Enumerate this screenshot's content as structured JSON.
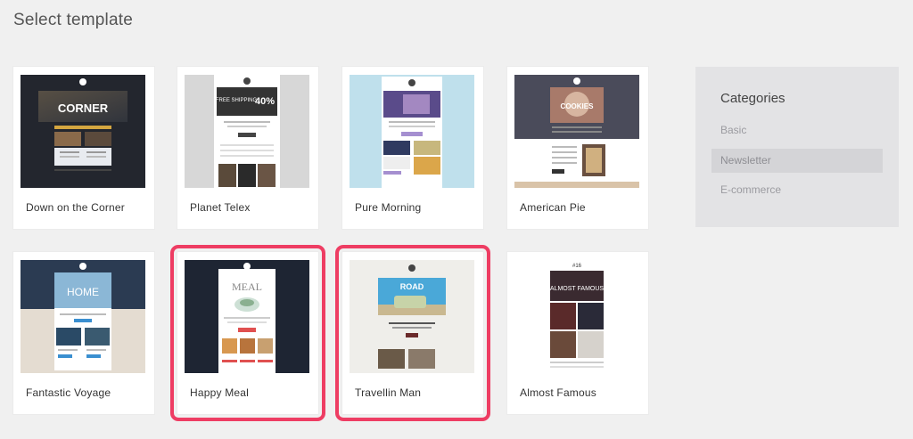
{
  "page": {
    "title": "Select template"
  },
  "templates": [
    {
      "name": "Down on the Corner",
      "selected": false,
      "banner_text": "CORNER"
    },
    {
      "name": "Planet Telex",
      "selected": false,
      "banner_text": "FREE SHIPPING",
      "badge_text": "40%"
    },
    {
      "name": "Pure Morning",
      "selected": false
    },
    {
      "name": "American Pie",
      "selected": false,
      "banner_text": "COOKIES"
    },
    {
      "name": "Fantastic Voyage",
      "selected": false,
      "banner_text": "HOME"
    },
    {
      "name": "Happy Meal",
      "selected": true,
      "banner_text": "MEAL"
    },
    {
      "name": "Travellin Man",
      "selected": true,
      "banner_text": "ROAD"
    },
    {
      "name": "Almost Famous",
      "selected": false,
      "banner_text": "ALMOST FAMOUS",
      "issue_text": "#16"
    }
  ],
  "categories": {
    "title": "Categories",
    "items": [
      {
        "label": "Basic",
        "active": false
      },
      {
        "label": "Newsletter",
        "active": true
      },
      {
        "label": "E-commerce",
        "active": false
      }
    ]
  },
  "colors": {
    "selection_outline": "#ee3d63",
    "panel_bg": "#e3e3e5"
  }
}
